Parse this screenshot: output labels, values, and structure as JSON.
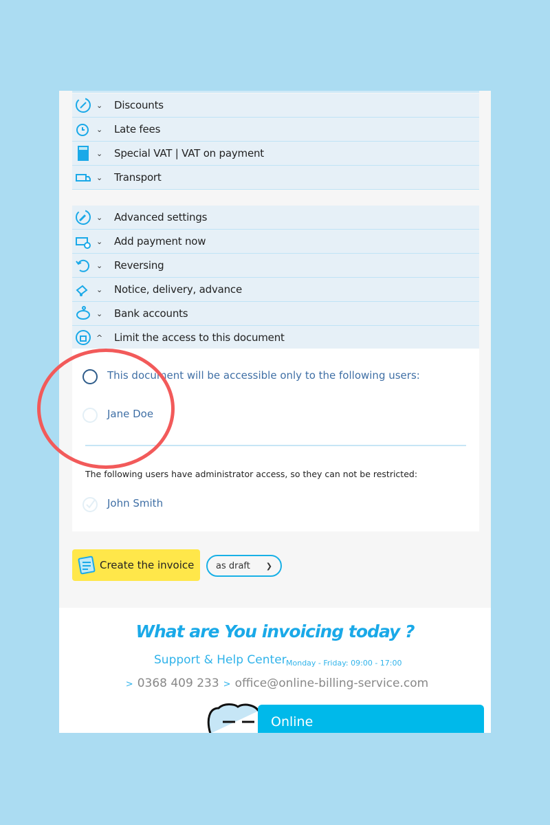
{
  "sections_a": [
    {
      "label": "Discounts",
      "icon": "percent-icon"
    },
    {
      "label": "Late fees",
      "icon": "alarm-clock-icon"
    },
    {
      "label": "Special VAT | VAT on payment",
      "icon": "calculator-icon"
    },
    {
      "label": "Transport",
      "icon": "truck-icon"
    }
  ],
  "sections_b": [
    {
      "label": "Advanced settings",
      "icon": "wrench-icon"
    },
    {
      "label": "Add payment now",
      "icon": "payment-icon"
    },
    {
      "label": "Reversing",
      "icon": "undo-icon"
    },
    {
      "label": "Notice, delivery, advance",
      "icon": "hand-truck-icon"
    },
    {
      "label": "Bank accounts",
      "icon": "piggy-bank-icon"
    },
    {
      "label": "Limit the access to this document",
      "icon": "lock-icon",
      "expanded": true
    }
  ],
  "access": {
    "intro": "This document will be accessible only to the following users:",
    "users": [
      {
        "name": "Jane Doe",
        "checked": false
      }
    ],
    "admin_note": "The following users have administrator access, so they can not be restricted:",
    "admins": [
      {
        "name": "John Smith",
        "checked": true
      }
    ]
  },
  "actions": {
    "create_label": "Create the invoice",
    "mode_value": "as draft"
  },
  "footer": {
    "slogan": "What are You invoicing today ?",
    "help": "Support & Help Center",
    "hours": "Monday - Friday: 09:00 - 17:00",
    "phone": "0368 409 233",
    "email": "office@online-billing-service.com",
    "chat_label": "Online"
  },
  "colors": {
    "accent": "#1aa9e8",
    "button": "#ffe74a",
    "highlight": "#f25a5a",
    "background": "#abdcf2"
  }
}
